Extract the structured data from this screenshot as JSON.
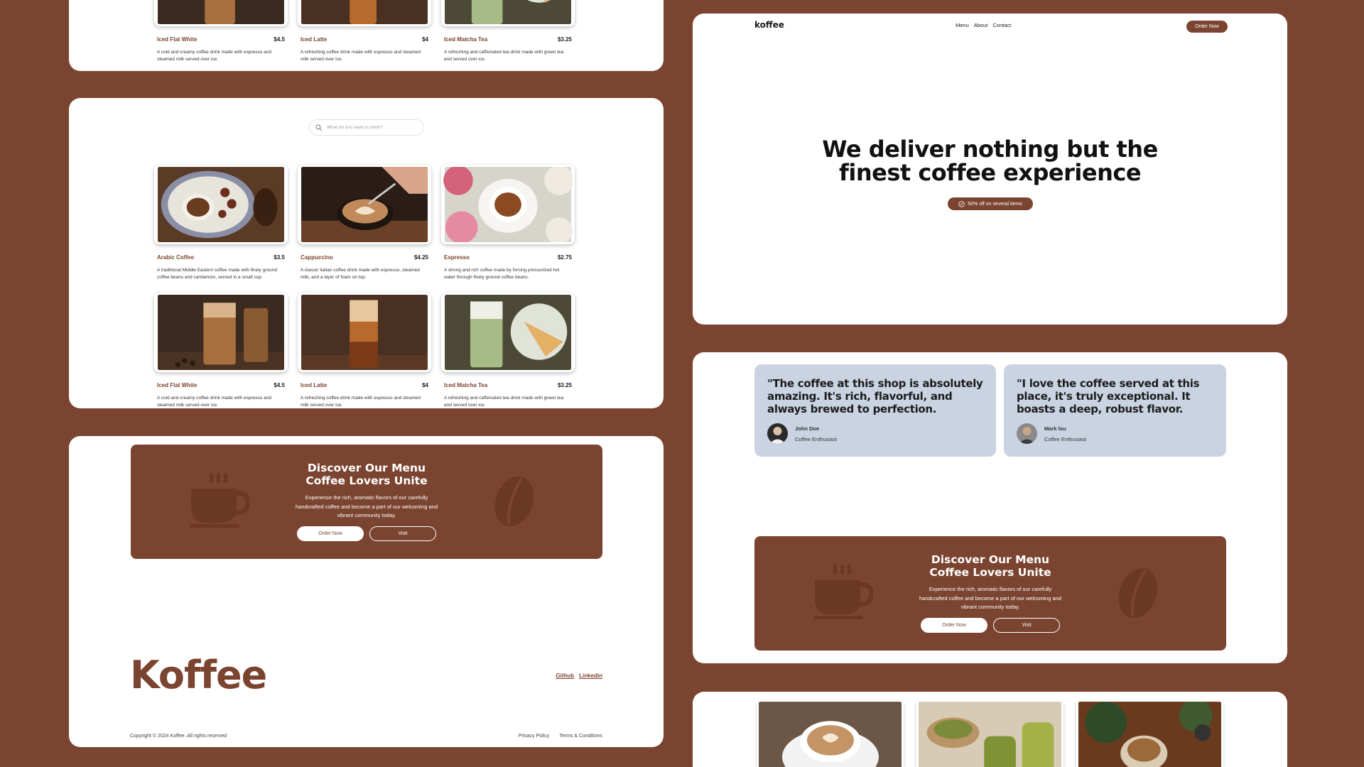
{
  "brand": "koffee",
  "nav": {
    "links": [
      "Menu",
      "About",
      "Contact"
    ],
    "order_label": "Order Now"
  },
  "hero": {
    "title_line1": "We deliver nothing but the",
    "title_line2": "finest coffee experience",
    "badge": "50% off on several items"
  },
  "search": {
    "placeholder": "What do you want to drink?"
  },
  "menu": {
    "items": [
      {
        "name": "Arabic Coffee",
        "price": "$3.5",
        "desc": "A traditional Middle Eastern coffee made with finely ground coffee beans and cardamom, served in a small cup."
      },
      {
        "name": "Cappuccino",
        "price": "$4.25",
        "desc": "A classic Italian coffee drink made with espresso, steamed milk, and a layer of foam on top."
      },
      {
        "name": "Espresso",
        "price": "$2.75",
        "desc": "A strong and rich coffee made by forcing pressurized hot water through finely ground coffee beans."
      },
      {
        "name": "Iced Flat White",
        "price": "$4.5",
        "desc": "A cold and creamy coffee drink made with espresso and steamed milk served over ice."
      },
      {
        "name": "Iced Latte",
        "price": "$4",
        "desc": "A refreshing coffee drink made with espresso and steamed milk served over ice."
      },
      {
        "name": "Iced Matcha Tea",
        "price": "$3.25",
        "desc": "A refreshing and caffeinated tea drink made with green tea and served over ice."
      }
    ]
  },
  "cta": {
    "title_line1": "Discover Our Menu",
    "title_line2": "Coffee Lovers Unite",
    "text": "Experience the rich, aromatic flavors of our carefully handcrafted coffee and become a part of our welcoming and vibrant community today.",
    "order_label": "Order Now",
    "visit_label": "Visit"
  },
  "footer": {
    "logo": "Koffee",
    "links": [
      "Github",
      "Linkedin"
    ],
    "copyright": "Copyright © 2024 Koffee. All rights reserved",
    "legal": [
      "Privacy Policy",
      "Terms & Conditions"
    ]
  },
  "testimonials": [
    {
      "quote": "\"The coffee at this shop is absolutely amazing. It's rich, flavorful, and always brewed to perfection.",
      "name": "John Doe",
      "role": "Coffee Enthusiast"
    },
    {
      "quote": "\"I love the coffee served at this place, it's truly exceptional. It boasts a deep, robust flavor.",
      "name": "Mark lou",
      "role": "Coffee Enthusiast"
    }
  ],
  "colors": {
    "brand_brown": "#7b4430",
    "testimonial_bg": "#c9d3e1",
    "card_bg": "#ffffff"
  }
}
